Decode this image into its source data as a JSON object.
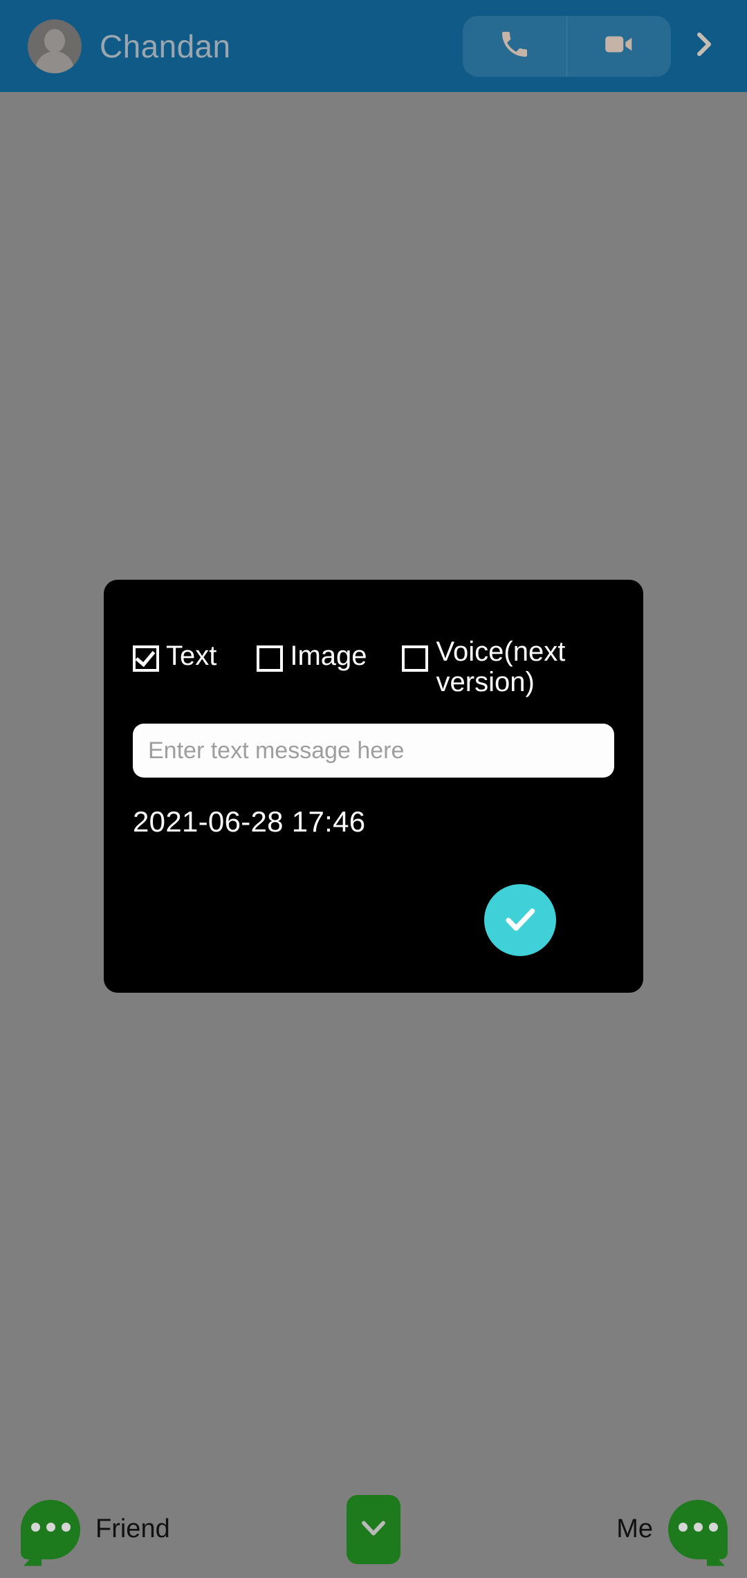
{
  "header": {
    "contact_name": "Chandan",
    "avatar_icon": "person-avatar-icon",
    "call_icon": "phone-icon",
    "video_icon": "video-camera-icon",
    "forward_icon": "chevron-right-icon",
    "background_color": "#0f5a86"
  },
  "overlay": {
    "scrim_color": "#7f7f7f"
  },
  "dialog": {
    "background_color": "#000000",
    "options": [
      {
        "label": "Text",
        "checked": true
      },
      {
        "label": "Image",
        "checked": false
      },
      {
        "label": "Voice(next version)",
        "checked": false
      }
    ],
    "message_input": {
      "value": "",
      "placeholder": "Enter text message here"
    },
    "timestamp": "2021-06-28 17:46",
    "confirm": {
      "icon": "check-icon",
      "color": "#3fd0d8"
    }
  },
  "bottom_bar": {
    "friend_label": "Friend",
    "friend_icon": "chat-bubble-icon",
    "scroll_down_icon": "chevron-down-icon",
    "me_label": "Me",
    "me_icon": "chat-bubble-icon",
    "accent_color": "#1d7a1d"
  }
}
